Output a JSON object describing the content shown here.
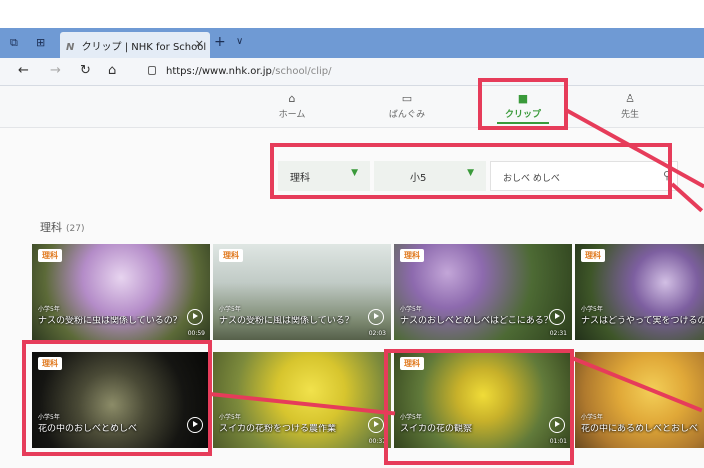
{
  "browser": {
    "tab_title": "クリップ | NHK for School",
    "tab_close": "×",
    "tab_new": "+",
    "tab_menu": "∨",
    "url_host": "https://www.nhk.or.jp",
    "url_path": "/school/clip/"
  },
  "nav": {
    "home": "ホーム",
    "programs": "ばんぐみ",
    "clips": "クリップ",
    "teachers": "先生",
    "active": "クリップ"
  },
  "filters": {
    "subject": "理科",
    "grade": "小5",
    "keyword": "おしべ めしべ"
  },
  "section": {
    "title": "理科",
    "count": "(27)"
  },
  "clips": [
    {
      "badge": "理科",
      "grade": "小学5年",
      "title": "ナスの受粉に虫は関係しているの？",
      "duration": "00:59"
    },
    {
      "badge": "理科",
      "grade": "小学5年",
      "title": "ナスの受粉に風は関係している？",
      "duration": "02:03"
    },
    {
      "badge": "理科",
      "grade": "小学5年",
      "title": "ナスのおしべとめしべはどこにある？",
      "duration": "02:31"
    },
    {
      "badge": "理科",
      "grade": "小学5年",
      "title": "ナスはどうやって実をつけるの？",
      "duration": ""
    },
    {
      "badge": "理科",
      "grade": "小学5年",
      "title": "花の中のおしべとめしべ",
      "duration": ""
    },
    {
      "badge": "",
      "grade": "小学5年",
      "title": "スイカの花粉をつける農作業",
      "duration": "00:37"
    },
    {
      "badge": "理科",
      "grade": "小学5年",
      "title": "スイカの花の観察",
      "duration": "01:01"
    },
    {
      "badge": "",
      "grade": "小学5年",
      "title": "花の中にあるめしべとおしべ",
      "duration": ""
    }
  ],
  "colors": {
    "accent_green": "#3a9a3a",
    "badge_orange": "#e07a20",
    "annotation_red": "#e63c5a",
    "tabbar_blue": "#6f9ad4"
  }
}
